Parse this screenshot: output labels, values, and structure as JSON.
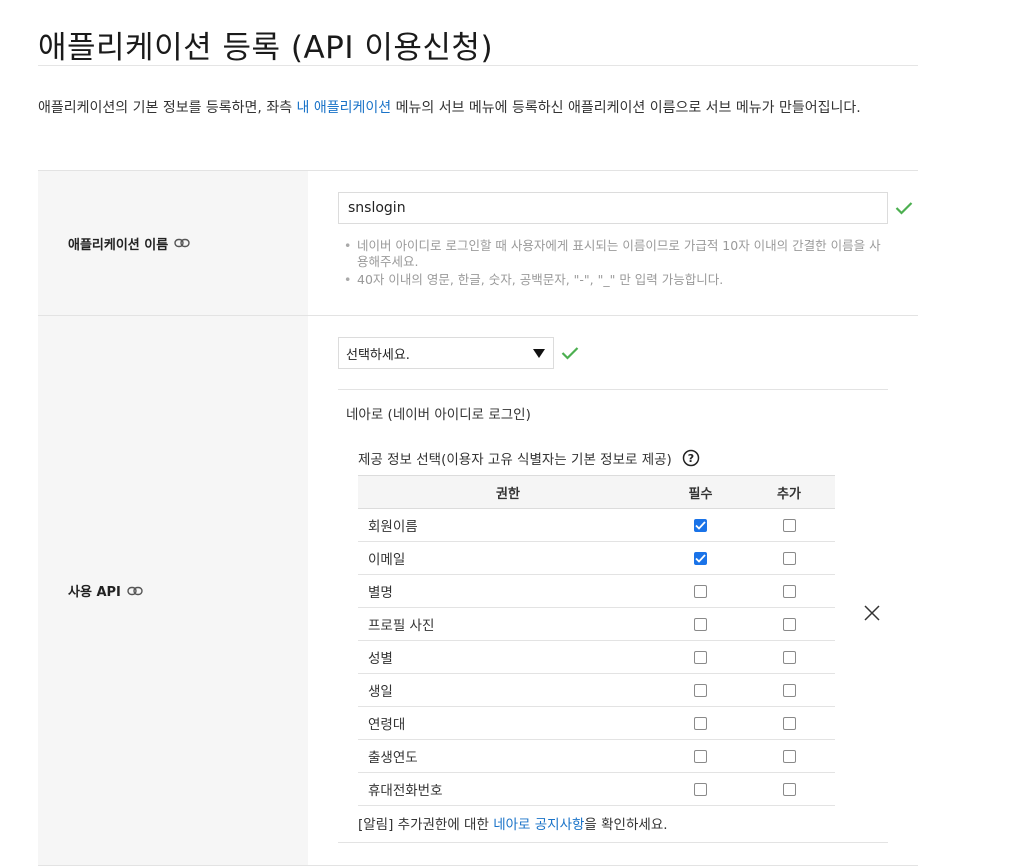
{
  "page": {
    "title": "애플리케이션 등록 (API 이용신청)"
  },
  "intro": {
    "text_before": "애플리케이션의 기본 정보를 등록하면, 좌측 ",
    "link_text": "내 애플리케이션",
    "text_after": " 메뉴의 서브 메뉴에 등록하신 애플리케이션 이름으로 서브 메뉴가 만들어집니다."
  },
  "app_name": {
    "label": "애플리케이션 이름",
    "value": "snslogin",
    "hints": [
      "네이버 아이디로 로그인할 때 사용자에게 표시되는 이름이므로 가급적 10자 이내의 간결한 이름을 사용해주세요.",
      "40자 이내의 영문, 한글, 숫자, 공백문자, \"-\", \"_\" 만 입력 가능합니다."
    ]
  },
  "api": {
    "label": "사용 API",
    "select_value": "선택하세요.",
    "panel": {
      "name": "네아로 (네이버 아이디로 로그인)",
      "provide_title": "제공 정보 선택(이용자 고유 식별자는 기본 정보로 제공)",
      "columns": {
        "permission": "권한",
        "required": "필수",
        "optional": "추가"
      },
      "rows": [
        {
          "name": "회원이름",
          "required": true,
          "optional": false
        },
        {
          "name": "이메일",
          "required": true,
          "optional": false
        },
        {
          "name": "별명",
          "required": false,
          "optional": false
        },
        {
          "name": "프로필 사진",
          "required": false,
          "optional": false
        },
        {
          "name": "성별",
          "required": false,
          "optional": false
        },
        {
          "name": "생일",
          "required": false,
          "optional": false
        },
        {
          "name": "연령대",
          "required": false,
          "optional": false
        },
        {
          "name": "출생연도",
          "required": false,
          "optional": false
        },
        {
          "name": "휴대전화번호",
          "required": false,
          "optional": false
        }
      ],
      "notice_before": "[알림] 추가권한에 대한 ",
      "notice_link": "네아로 공지사항",
      "notice_after": "을 확인하세요."
    }
  },
  "colors": {
    "link": "#1a73c8",
    "valid_check": "#4caf50",
    "checkbox_checked": "#1a73e8",
    "label_bg": "#f6f6f6"
  }
}
